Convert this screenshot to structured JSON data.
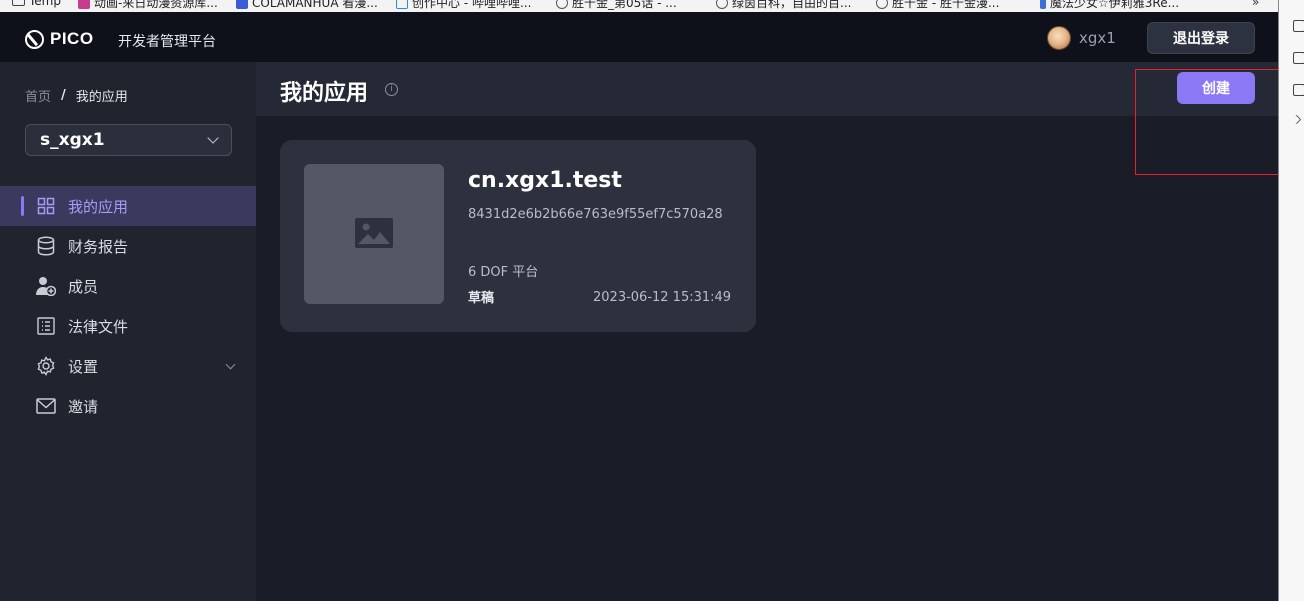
{
  "bookmarks": {
    "items": [
      {
        "label": "Temp",
        "color": "#444444"
      },
      {
        "label": "动画-来日动漫资源库...",
        "color": "#c83c8c"
      },
      {
        "label": "COLAMANHUA 看漫...",
        "color": "#3b5bd6"
      },
      {
        "label": "创作中心 - 哔哩哔哩...",
        "color": "#2a8cd4"
      },
      {
        "label": "胜千金_第05话 - ...",
        "color": "#555555"
      },
      {
        "label": "绿茵百科，自由的百...",
        "color": "#555555"
      },
      {
        "label": "胜千金 - 胜千金漫...",
        "color": "#555555"
      },
      {
        "label": "魔法少女☆伊莉雅3Re...",
        "color": "#3b6fd6"
      }
    ],
    "more_label": "»"
  },
  "nav": {
    "logo_text": "PICO",
    "platform_label": "开发者管理平台",
    "username": "xgx1",
    "logout_label": "退出登录"
  },
  "sidebar": {
    "breadcrumb": {
      "home": "首页",
      "separator": "/",
      "current": "我的应用"
    },
    "org_select": {
      "value": "s_xgx1"
    },
    "items": [
      {
        "label": "我的应用",
        "icon": "grid-icon",
        "active": true
      },
      {
        "label": "财务报告",
        "icon": "database-icon",
        "active": false
      },
      {
        "label": "成员",
        "icon": "user-add-icon",
        "active": false
      },
      {
        "label": "法律文件",
        "icon": "document-list-icon",
        "active": false
      },
      {
        "label": "设置",
        "icon": "gear-icon",
        "active": false,
        "expandable": true
      },
      {
        "label": "邀请",
        "icon": "mail-icon",
        "active": false
      }
    ]
  },
  "page": {
    "title": "我的应用",
    "info_icon": "i",
    "create_label": "创建"
  },
  "apps": [
    {
      "name": "cn.xgx1.test",
      "id": "8431d2e6b2b66e763e9f55ef7c570a28",
      "platform": "6 DOF 平台",
      "status": "草稿",
      "date": "2023-06-12 15:31:49"
    }
  ],
  "colors": {
    "accent": "#8b78f5",
    "highlight_box": "#e8202a",
    "background": "#1a1d27"
  }
}
